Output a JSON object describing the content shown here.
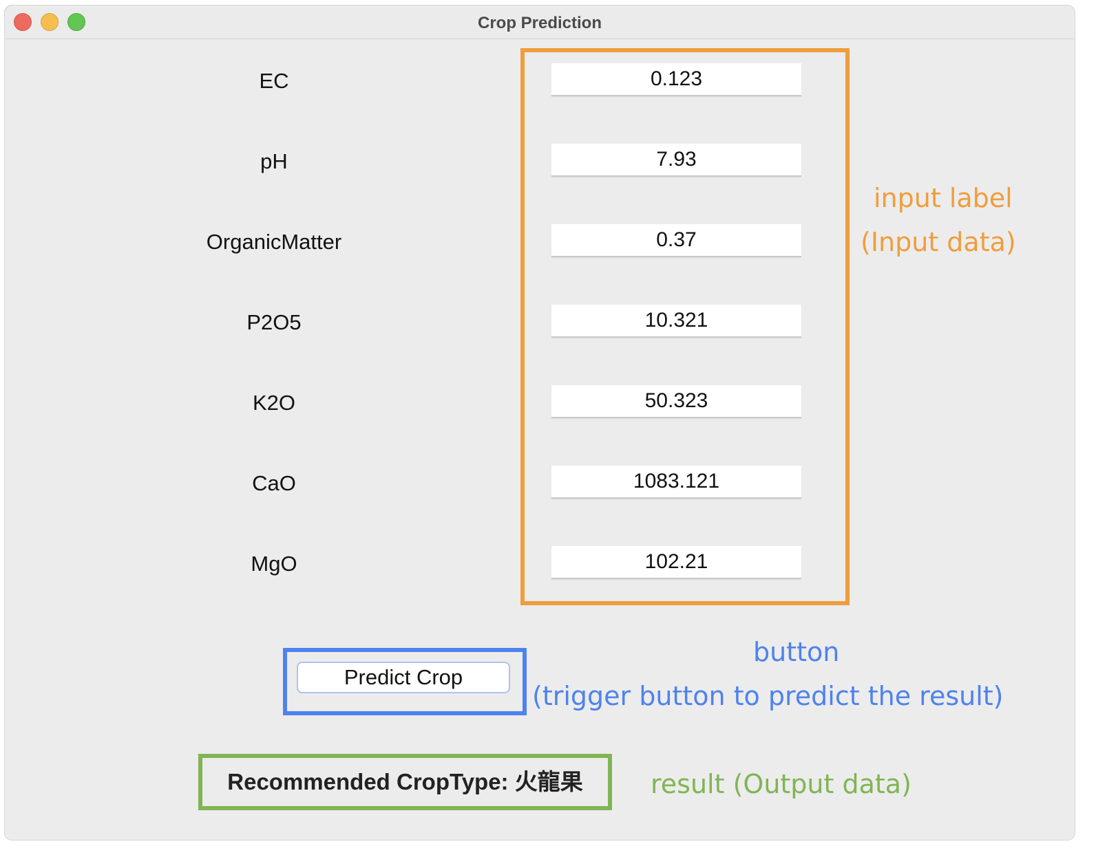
{
  "window": {
    "title": "Crop Prediction"
  },
  "form": {
    "fields": [
      {
        "label": "EC",
        "value": "0.123"
      },
      {
        "label": "pH",
        "value": "7.93"
      },
      {
        "label": "OrganicMatter",
        "value": "0.37"
      },
      {
        "label": "P2O5",
        "value": "10.321"
      },
      {
        "label": "K2O",
        "value": "50.323"
      },
      {
        "label": "CaO",
        "value": "1083.121"
      },
      {
        "label": "MgO",
        "value": "102.21"
      }
    ],
    "predict_button_label": "Predict Crop",
    "result_text": "Recommended CropType: 火龍果"
  },
  "annotations": {
    "input_title": "input label",
    "input_subtitle": "(Input data)",
    "button_title": "button",
    "button_subtitle": "(trigger button to predict the result)",
    "result_note": "result (Output data)"
  },
  "colors": {
    "input_annotation": "#f09d3d",
    "button_annotation": "#4e82ee",
    "result_annotation": "#80b553"
  }
}
